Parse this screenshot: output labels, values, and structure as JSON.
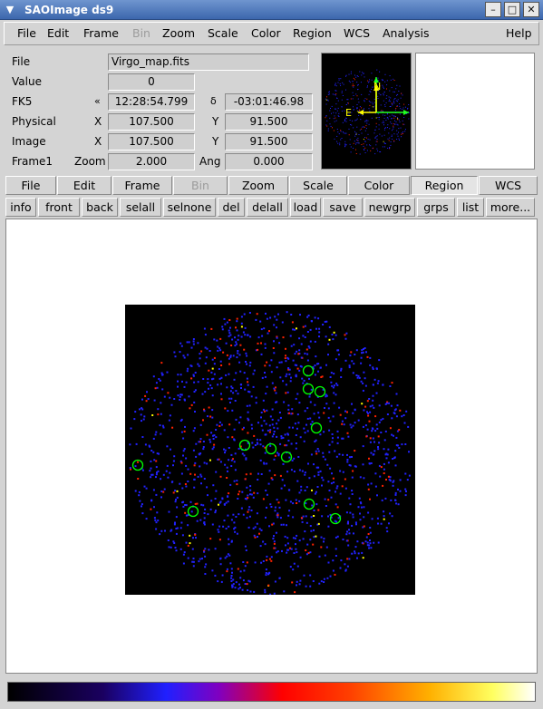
{
  "window": {
    "title": "SAOImage ds9",
    "controls": {
      "minimize": "–",
      "maximize": "□",
      "close": "✕"
    },
    "menu_icon": "chevron-down-icon"
  },
  "menubar": {
    "items": [
      {
        "label": "File"
      },
      {
        "label": "Edit"
      },
      {
        "label": "Frame"
      },
      {
        "label": "Bin",
        "disabled": true
      },
      {
        "label": "Zoom"
      },
      {
        "label": "Scale"
      },
      {
        "label": "Color"
      },
      {
        "label": "Region"
      },
      {
        "label": "WCS"
      },
      {
        "label": "Analysis"
      },
      {
        "label": "Help"
      }
    ]
  },
  "info": {
    "file_label": "File",
    "file_value": "Virgo_map.fits",
    "value_label": "Value",
    "value_value": "0",
    "fk5_label": "FK5",
    "fk5_alpha_symbol": "«",
    "fk5_ra": "12:28:54.799",
    "fk5_delta_symbol": "δ",
    "fk5_dec": "-03:01:46.98",
    "physical_label": "Physical",
    "physical_x_label": "X",
    "physical_x": "107.500",
    "physical_y_label": "Y",
    "physical_y": "91.500",
    "image_label": "Image",
    "image_x_label": "X",
    "image_x": "107.500",
    "image_y_label": "Y",
    "image_y": "91.500",
    "frame_label": "Frame1",
    "zoom_label": "Zoom",
    "zoom_value": "2.000",
    "ang_label": "Ang",
    "ang_value": "0.000"
  },
  "panner": {
    "north_label": "N",
    "east_label": "E"
  },
  "buttonbar": {
    "items": [
      {
        "label": "File"
      },
      {
        "label": "Edit"
      },
      {
        "label": "Frame"
      },
      {
        "label": "Bin",
        "disabled": true
      },
      {
        "label": "Zoom"
      },
      {
        "label": "Scale"
      },
      {
        "label": "Color"
      },
      {
        "label": "Region",
        "active": true
      },
      {
        "label": "WCS"
      }
    ]
  },
  "regionbar": {
    "items": [
      {
        "label": "info"
      },
      {
        "label": "front"
      },
      {
        "label": "back"
      },
      {
        "label": "selall"
      },
      {
        "label": "selnone"
      },
      {
        "label": "del"
      },
      {
        "label": "delall"
      },
      {
        "label": "load"
      },
      {
        "label": "save"
      },
      {
        "label": "newgrp"
      },
      {
        "label": "grps"
      },
      {
        "label": "list"
      },
      {
        "label": "more..."
      }
    ]
  },
  "colors": {
    "titlebar": "#4a74b8",
    "region_circle": "#00ff00",
    "photon_blue": "#2222ff",
    "photon_red": "#ff2200",
    "photon_yellow": "#ffff00",
    "background": "#000000"
  }
}
